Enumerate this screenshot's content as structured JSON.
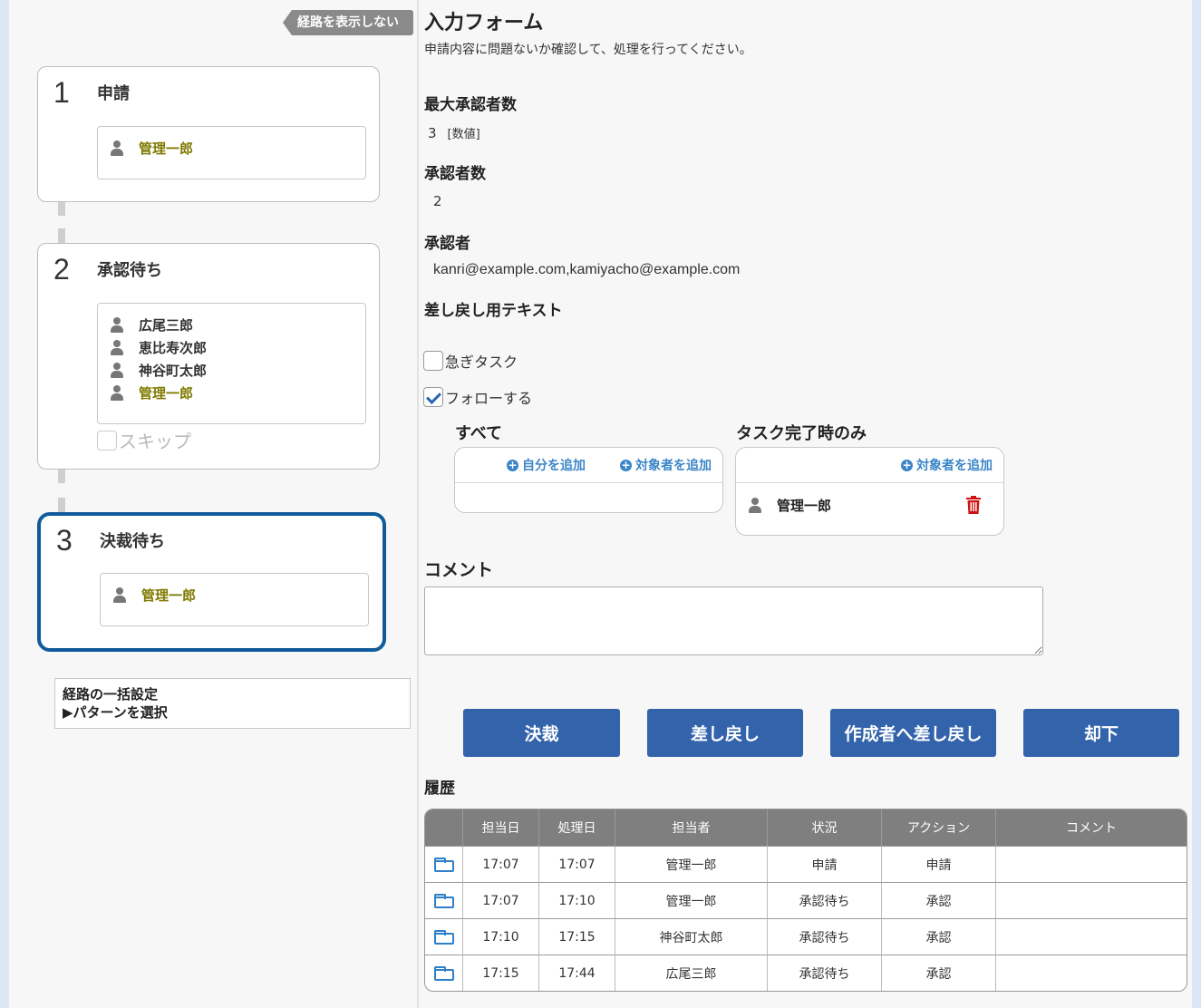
{
  "route": {
    "toggle_label": "経路を表示しない",
    "steps": [
      {
        "number": "1",
        "title": "申請",
        "members": [
          "管理一郎"
        ]
      },
      {
        "number": "2",
        "title": "承認待ち",
        "members": [
          "広尾三郎",
          "恵比寿次郎",
          "神谷町太郎",
          "管理一郎"
        ],
        "skip_label": "スキップ"
      },
      {
        "number": "3",
        "title": "決裁待ち",
        "members": [
          "管理一郎"
        ]
      }
    ],
    "pattern": {
      "title": "経路の一括設定",
      "select_label": "▶パターンを選択"
    }
  },
  "form": {
    "title": "入力フォーム",
    "description": "申請内容に問題ないか確認して、処理を行ってください。",
    "fields": {
      "max_approvers": {
        "label": "最大承認者数",
        "value": "3",
        "unit": "[数値]"
      },
      "approver_count": {
        "label": "承認者数",
        "value": "2"
      },
      "approvers": {
        "label": "承認者",
        "value": "kanri@example.com,kamiyacho@example.com"
      },
      "reject_text": {
        "label": "差し戻し用テキスト"
      }
    },
    "urgent_label": "急ぎタスク",
    "follow_label": "フォローする",
    "follow": {
      "all": {
        "label": "すべて",
        "add_self": "自分を追加",
        "add_target": "対象者を追加"
      },
      "on_complete": {
        "label": "タスク完了時のみ",
        "add_target": "対象者を追加",
        "member": "管理一郎"
      }
    },
    "comment_label": "コメント",
    "comment_value": "",
    "buttons": {
      "approve": "決裁",
      "reject": "差し戻し",
      "reject_to_creator": "作成者へ差し戻し",
      "decline": "却下"
    }
  },
  "history": {
    "title": "履歴",
    "columns": [
      "",
      "担当日",
      "処理日",
      "担当者",
      "状況",
      "アクション",
      "コメント"
    ],
    "rows": [
      {
        "assigned": "17:07",
        "processed": "17:07",
        "person": "管理一郎",
        "status": "申請",
        "action": "申請",
        "comment": ""
      },
      {
        "assigned": "17:07",
        "processed": "17:10",
        "person": "管理一郎",
        "status": "承認待ち",
        "action": "承認",
        "comment": ""
      },
      {
        "assigned": "17:10",
        "processed": "17:15",
        "person": "神谷町太郎",
        "status": "承認待ち",
        "action": "承認",
        "comment": ""
      },
      {
        "assigned": "17:15",
        "processed": "17:44",
        "person": "広尾三郎",
        "status": "承認待ち",
        "action": "承認",
        "comment": ""
      }
    ]
  },
  "colors": {
    "accent": "#3263ab",
    "active_border": "#0f5a9a",
    "highlight_name": "#7f7a00",
    "link": "#3a85c8",
    "trash": "#cc1111"
  }
}
